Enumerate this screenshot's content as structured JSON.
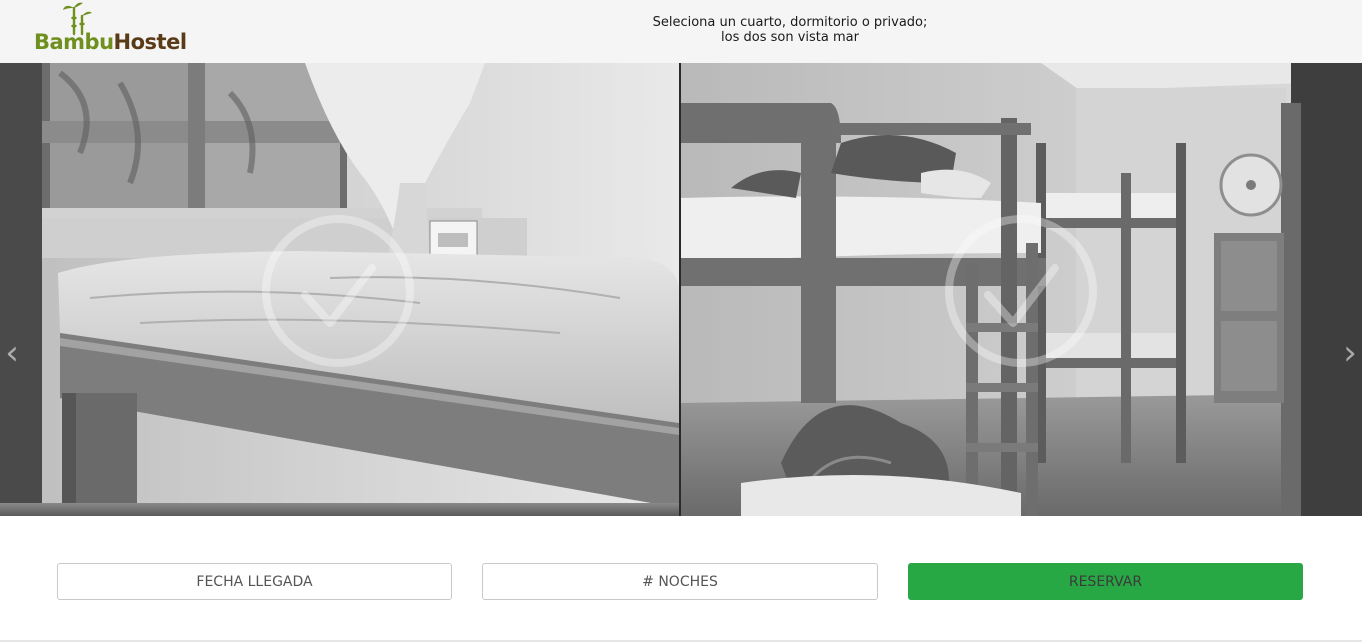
{
  "header": {
    "logo": {
      "brand_part1": "Bambu",
      "brand_part2": "Hostel"
    },
    "tagline": {
      "line1": "Seleciona un cuarto, dormitorio o privado;",
      "line2": "los dos son vista mar"
    }
  },
  "gallery": {
    "prev_icon": "chevron-left-icon",
    "next_icon": "chevron-right-icon",
    "prev_glyph": "‹",
    "next_glyph": "›",
    "overlay_icon": "checkmark-circle-icon"
  },
  "booking": {
    "date_label": "FECHA LLEGADA",
    "nights_label": "# NOCHES",
    "reserve_label": "RESERVAR"
  },
  "colors": {
    "header_bg": "#f5f5f5",
    "brand_green": "#6f8f1f",
    "brand_brown": "#5a3b17",
    "reserve_green": "#27a844"
  }
}
